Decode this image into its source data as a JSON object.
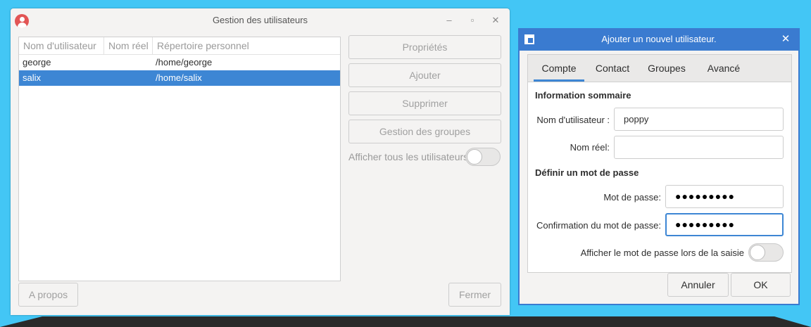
{
  "main_window": {
    "title": "Gestion des utilisateurs",
    "controls": {
      "minimize": "–",
      "maximize": "▫",
      "close": "✕"
    },
    "columns": [
      "Nom d'utilisateur",
      "Nom réel",
      "Répertoire personnel"
    ],
    "rows": [
      {
        "username": "george",
        "real_name": "",
        "home": "/home/george",
        "selected": false
      },
      {
        "username": "salix",
        "real_name": "",
        "home": "/home/salix",
        "selected": true
      }
    ],
    "buttons": {
      "properties": "Propriétés",
      "add": "Ajouter",
      "remove": "Supprimer",
      "groups": "Gestion des groupes",
      "about": "A propos",
      "close": "Fermer"
    },
    "show_all_users": {
      "label": "Afficher tous les utilisateurs",
      "on": false
    }
  },
  "dialog": {
    "title": "Ajouter un nouvel utilisateur.",
    "close_icon": "✕",
    "tabs": [
      "Compte",
      "Contact",
      "Groupes",
      "Avancé"
    ],
    "active_tab": "Compte",
    "summary_title": "Information sommaire",
    "username_label": "Nom d'utilisateur :",
    "username_value": "poppy",
    "realname_label": "Nom réel:",
    "realname_value": "",
    "password_section": "Définir un mot de passe",
    "password_label": "Mot de passe:",
    "password_value": "●●●●●●●●●",
    "confirm_label": "Confirmation du mot de passe:",
    "confirm_value": "●●●●●●●●●",
    "show_password": {
      "label": "Afficher le mot de passe lors de la saisie",
      "on": false
    },
    "cancel_label": "Annuler",
    "ok_label": "OK"
  },
  "colors": {
    "desktop": "#43c6f5",
    "selection": "#3d86d4",
    "dialog_titlebar": "#3a7bd0",
    "taskbar": "#2a2a2a"
  }
}
